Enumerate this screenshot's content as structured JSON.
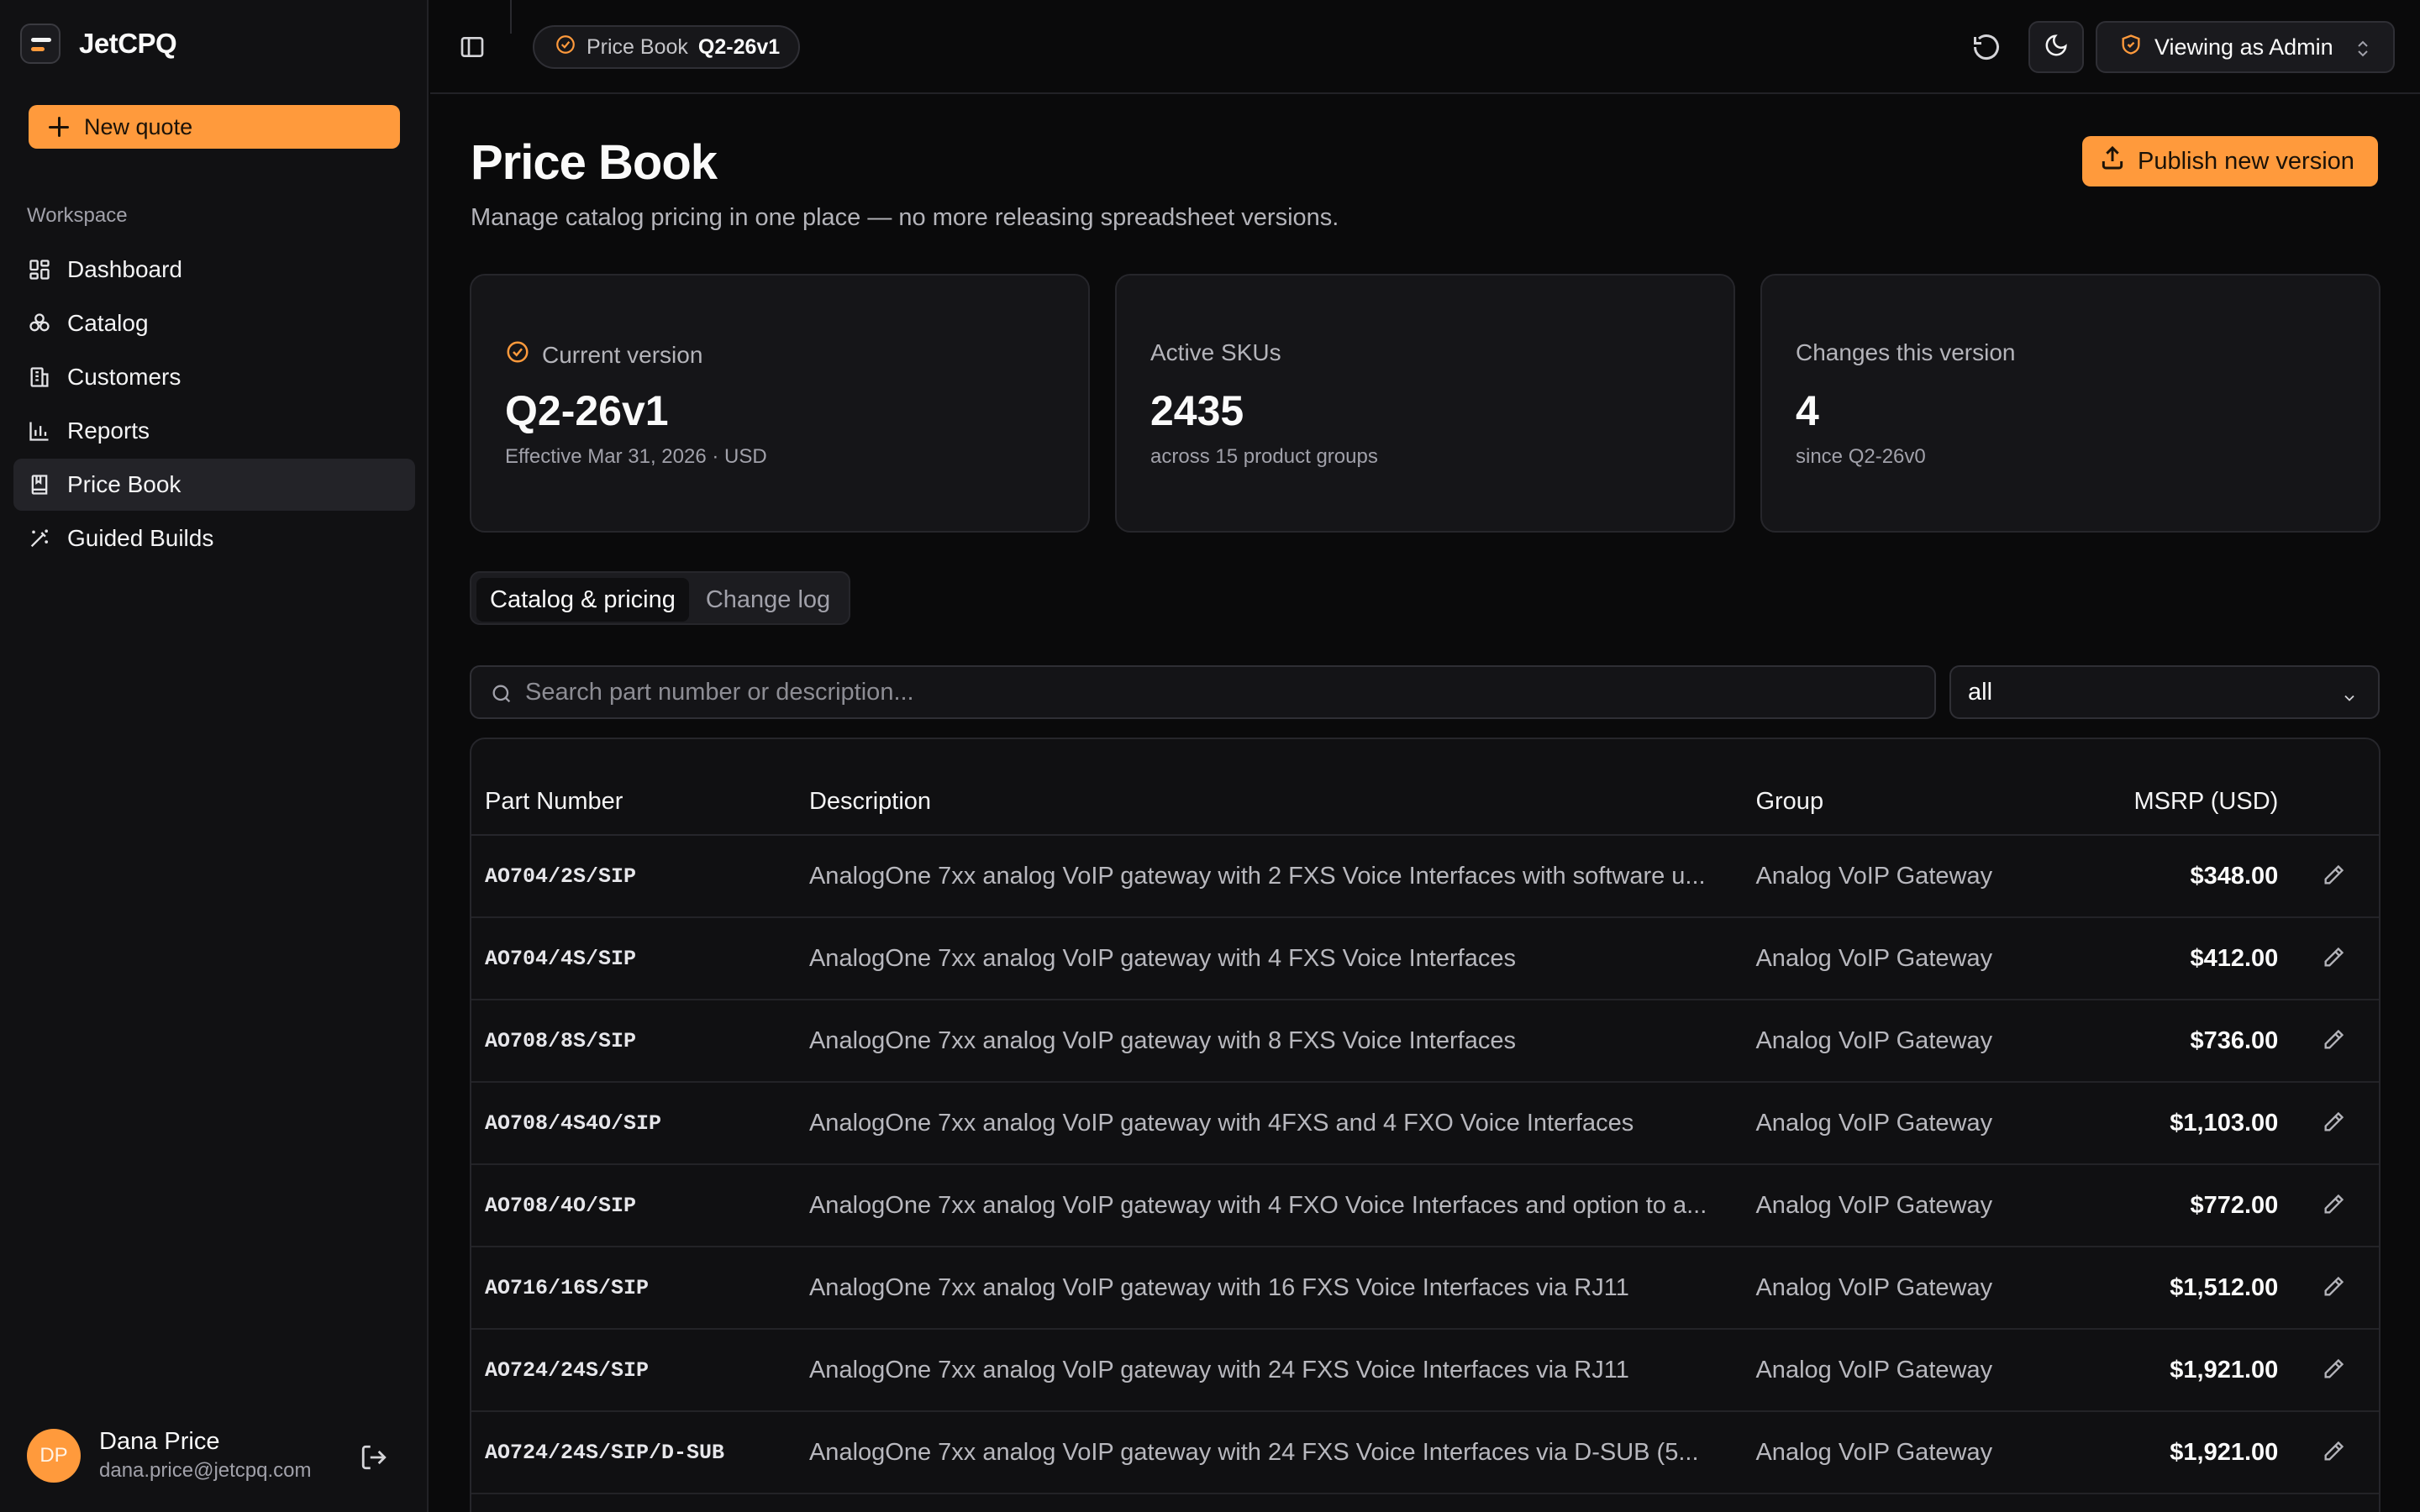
{
  "app": {
    "name": "JetCPQ"
  },
  "sidebar": {
    "new_quote_label": "New quote",
    "section_label": "Workspace",
    "items": [
      {
        "label": "Dashboard",
        "icon": "dashboard-icon"
      },
      {
        "label": "Catalog",
        "icon": "boxes-icon"
      },
      {
        "label": "Customers",
        "icon": "building-icon"
      },
      {
        "label": "Reports",
        "icon": "bar-chart-icon"
      },
      {
        "label": "Price Book",
        "icon": "book-icon",
        "active": true
      },
      {
        "label": "Guided Builds",
        "icon": "magic-wand-icon"
      }
    ],
    "user": {
      "initials": "DP",
      "name": "Dana Price",
      "email": "dana.price@jetcpq.com"
    }
  },
  "topbar": {
    "breadcrumb_label": "Price Book",
    "breadcrumb_version": "Q2-26v1",
    "role_label": "Viewing as Admin"
  },
  "page": {
    "title": "Price Book",
    "subtitle": "Manage catalog pricing in one place — no more releasing spreadsheet versions.",
    "publish_label": "Publish new version"
  },
  "cards": [
    {
      "label": "Current version",
      "value": "Q2-26v1",
      "note": "Effective Mar 31, 2026 · USD"
    },
    {
      "label": "Active SKUs",
      "value": "2435",
      "note": "across 15 product groups"
    },
    {
      "label": "Changes this version",
      "value": "4",
      "note": "since Q2-26v0"
    }
  ],
  "tabs": [
    {
      "label": "Catalog & pricing",
      "active": true
    },
    {
      "label": "Change log",
      "active": false
    }
  ],
  "filters": {
    "search_placeholder": "Search part number or description...",
    "group_value": "all"
  },
  "table": {
    "headers": {
      "part": "Part Number",
      "desc": "Description",
      "group": "Group",
      "msrp": "MSRP (USD)"
    },
    "rows": [
      {
        "part": "AO704/2S/SIP",
        "desc": "AnalogOne 7xx analog VoIP gateway with 2 FXS Voice Interfaces with software u...",
        "group": "Analog VoIP Gateway",
        "msrp": "$348.00"
      },
      {
        "part": "AO704/4S/SIP",
        "desc": "AnalogOne 7xx analog VoIP gateway with 4 FXS Voice Interfaces",
        "group": "Analog VoIP Gateway",
        "msrp": "$412.00"
      },
      {
        "part": "AO708/8S/SIP",
        "desc": "AnalogOne 7xx analog VoIP gateway with 8 FXS Voice Interfaces",
        "group": "Analog VoIP Gateway",
        "msrp": "$736.00"
      },
      {
        "part": "AO708/4S4O/SIP",
        "desc": "AnalogOne 7xx analog VoIP gateway with 4FXS and 4 FXO Voice Interfaces",
        "group": "Analog VoIP Gateway",
        "msrp": "$1,103.00"
      },
      {
        "part": "AO708/4O/SIP",
        "desc": "AnalogOne 7xx analog VoIP gateway with 4 FXO Voice Interfaces and option to a...",
        "group": "Analog VoIP Gateway",
        "msrp": "$772.00"
      },
      {
        "part": "AO716/16S/SIP",
        "desc": "AnalogOne 7xx analog VoIP gateway with 16 FXS Voice Interfaces via RJ11",
        "group": "Analog VoIP Gateway",
        "msrp": "$1,512.00"
      },
      {
        "part": "AO724/24S/SIP",
        "desc": "AnalogOne 7xx analog VoIP gateway with 24 FXS Voice Interfaces via RJ11",
        "group": "Analog VoIP Gateway",
        "msrp": "$1,921.00"
      },
      {
        "part": "AO724/24S/SIP/D-SUB",
        "desc": "AnalogOne 7xx analog VoIP gateway with 24 FXS Voice Interfaces via D-SUB (5...",
        "group": "Analog VoIP Gateway",
        "msrp": "$1,921.00"
      }
    ]
  },
  "colors": {
    "accent": "#ff9a3c",
    "background": "#0a0a0b",
    "sidebar": "#111113",
    "card": "#151518"
  }
}
